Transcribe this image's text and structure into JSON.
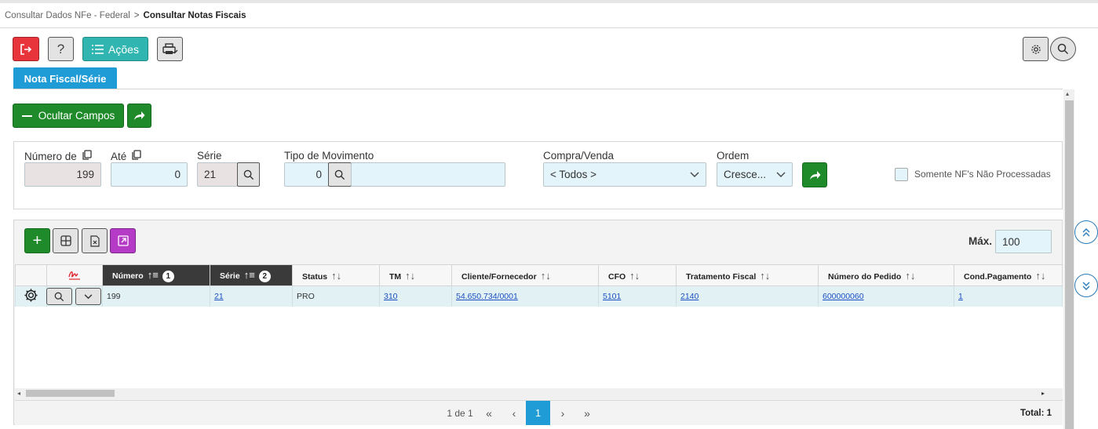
{
  "breadcrumb": {
    "parent": "Consultar Dados NFe - Federal",
    "separator": ">",
    "current": "Consultar Notas Fiscais"
  },
  "toolbar": {
    "help_label": "?",
    "actions_label": "Ações"
  },
  "tab": {
    "label": "Nota Fiscal/Série"
  },
  "filters": {
    "hide_fields_label": "Ocultar Campos",
    "numero_de": {
      "label": "Número de",
      "value": "199"
    },
    "ate": {
      "label": "Até",
      "value": "0"
    },
    "serie": {
      "label": "Série",
      "value": "21"
    },
    "tipo_movimento": {
      "label": "Tipo de Movimento",
      "value": "0",
      "description": ""
    },
    "compra_venda": {
      "label": "Compra/Venda",
      "value": "< Todos >"
    },
    "ordem": {
      "label": "Ordem",
      "value": "Cresce..."
    },
    "somente_nf": {
      "label": "Somente NF's Não Processadas",
      "checked": false
    }
  },
  "grid": {
    "max_label": "Máx.",
    "max_value": "100",
    "columns": [
      {
        "label": "Número",
        "badge": "1"
      },
      {
        "label": "Série",
        "badge": "2"
      },
      {
        "label": "Status"
      },
      {
        "label": "TM"
      },
      {
        "label": "Cliente/Fornecedor"
      },
      {
        "label": "CFO"
      },
      {
        "label": "Tratamento Fiscal"
      },
      {
        "label": "Número do Pedido"
      },
      {
        "label": "Cond.Pagamento"
      }
    ],
    "rows": [
      {
        "numero": "199",
        "serie": "21",
        "status": "PRO",
        "tm": "310",
        "cliente": "54.650.734/0001",
        "cfo": "5101",
        "tratamento": "2140",
        "pedido": "600000060",
        "cond_pagamento": "1"
      }
    ]
  },
  "pager": {
    "info": "1 de 1",
    "current_page": "1",
    "total": "Total: 1"
  },
  "colors": {
    "red": "#e8343b",
    "teal": "#30b5b0",
    "green": "#1f8a2a",
    "blue": "#1f9bd6",
    "purple": "#b53bc6",
    "input_bg": "#e3f4fb"
  }
}
